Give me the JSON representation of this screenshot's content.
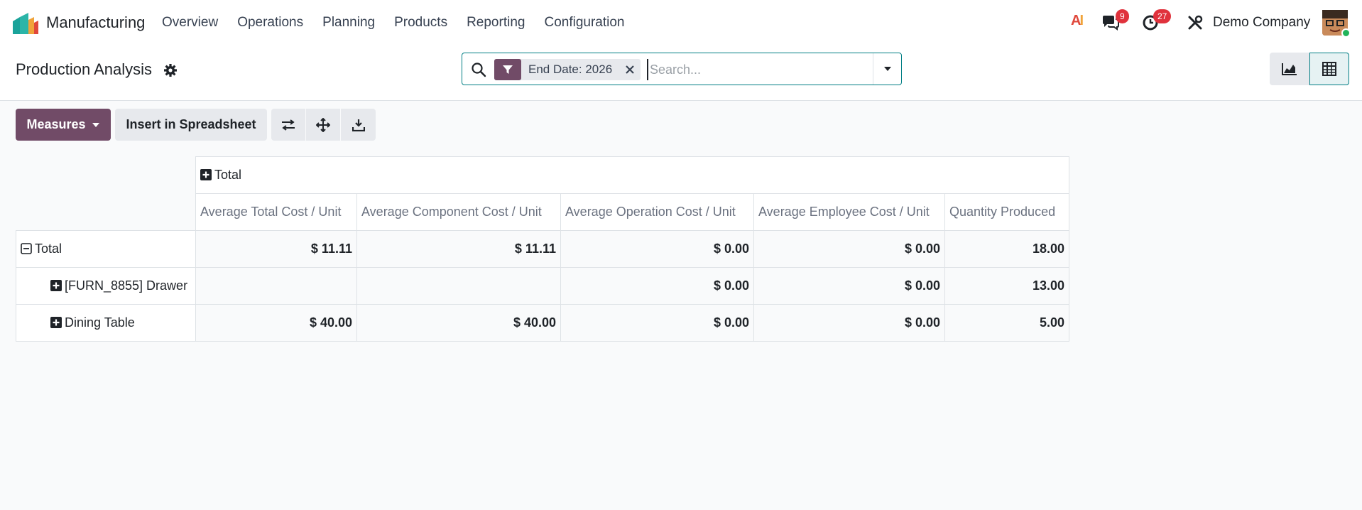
{
  "navbar": {
    "app_name": "Manufacturing",
    "menu": [
      "Overview",
      "Operations",
      "Planning",
      "Products",
      "Reporting",
      "Configuration"
    ],
    "ai_label": "AI",
    "messages_count": "9",
    "activities_count": "27",
    "company": "Demo Company"
  },
  "control_panel": {
    "title": "Production Analysis",
    "facet_label": "End Date: 2026",
    "search_placeholder": "Search..."
  },
  "toolbar": {
    "measures_label": "Measures",
    "spreadsheet_label": "Insert in Spreadsheet"
  },
  "pivot": {
    "col_total": "Total",
    "measures": [
      "Average Total Cost / Unit",
      "Average Component Cost / Unit",
      "Average Operation Cost / Unit",
      "Average Employee Cost / Unit",
      "Quantity Produced"
    ],
    "rows": [
      {
        "label": "Total",
        "values": [
          "$ 11.11",
          "$ 11.11",
          "$ 0.00",
          "$ 0.00",
          "18.00"
        ]
      },
      {
        "label": "[FURN_8855] Drawer",
        "values": [
          "",
          "",
          "$ 0.00",
          "$ 0.00",
          "13.00"
        ]
      },
      {
        "label": "Dining Table",
        "values": [
          "$ 40.00",
          "$ 40.00",
          "$ 0.00",
          "$ 0.00",
          "5.00"
        ]
      }
    ]
  },
  "colors": {
    "brand": "#714b67",
    "accent": "#017e84",
    "badge": "#e0323c"
  }
}
